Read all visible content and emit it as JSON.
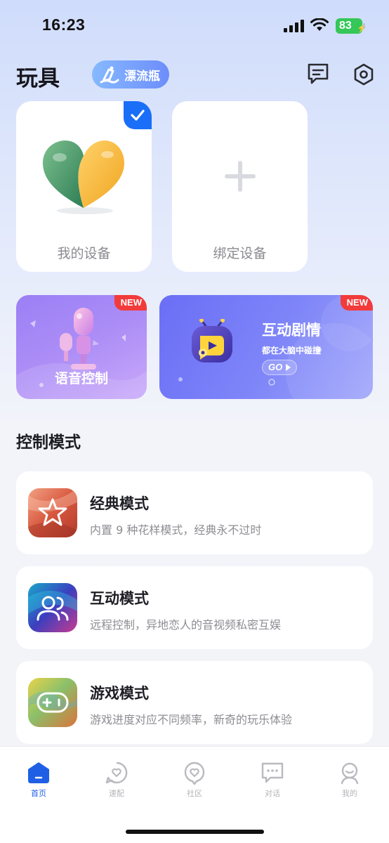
{
  "status_bar": {
    "time": "16:23",
    "battery": "83"
  },
  "header": {
    "title": "玩具",
    "bottle_label": "漂流瓶"
  },
  "devices": [
    {
      "label": "我的设备",
      "selected": true
    },
    {
      "label": "绑定设备",
      "selected": false
    }
  ],
  "banners": {
    "voice": {
      "label": "语音控制",
      "badge": "NEW"
    },
    "story": {
      "title": "互动剧情",
      "subtitle": "都在大脑中碰撞",
      "go_label": "GO",
      "badge": "NEW"
    }
  },
  "control_section": {
    "title": "控制模式",
    "modes": [
      {
        "title": "经典模式",
        "desc": "内置 9 种花样模式，经典永不过时",
        "icon": "star-icon"
      },
      {
        "title": "互动模式",
        "desc": "远程控制，异地恋人的音视频私密互娱",
        "icon": "users-icon"
      },
      {
        "title": "游戏模式",
        "desc": "游戏进度对应不同频率，新奇的玩乐体验",
        "icon": "gamepad-icon"
      }
    ]
  },
  "tab_bar": {
    "active": "首页",
    "items": [
      {
        "label": "首页",
        "icon": "home-icon"
      },
      {
        "label": "速配",
        "icon": "match-heart-icon"
      },
      {
        "label": "社区",
        "icon": "community-heart-icon"
      },
      {
        "label": "对话",
        "icon": "chat-icon"
      },
      {
        "label": "我的",
        "icon": "profile-icon"
      }
    ]
  },
  "colors": {
    "accent": "#1b6ef7",
    "badge_red": "#f23b3b",
    "voice_banner": "#a58af6",
    "story_banner": "#7278f7"
  }
}
